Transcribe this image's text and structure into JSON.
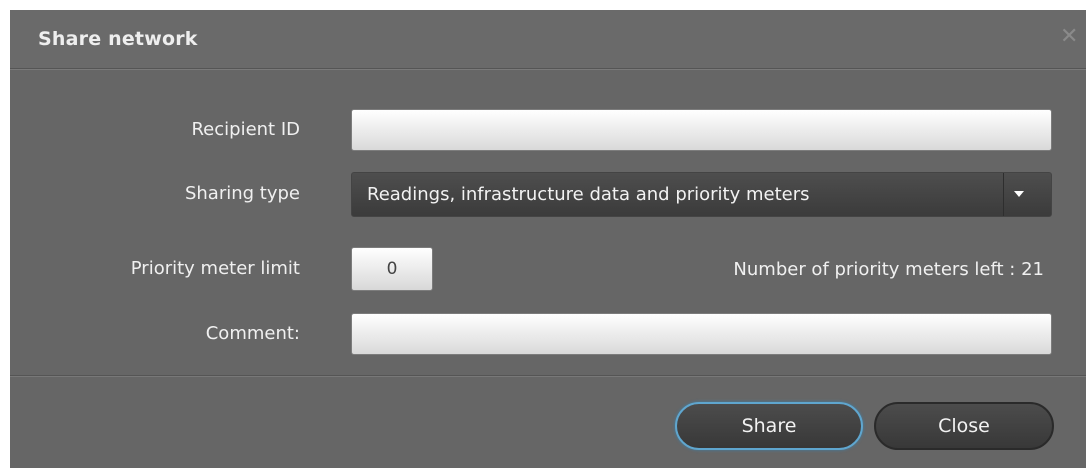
{
  "dialog": {
    "title": "Share network",
    "close_icon": "close-icon",
    "close_glyph": "✕"
  },
  "form": {
    "recipient": {
      "label": "Recipient ID",
      "value": "",
      "placeholder": ""
    },
    "sharing_type": {
      "label": "Sharing type",
      "selected": "Readings, infrastructure data and priority meters",
      "arrow_icon": "chevron-down-icon"
    },
    "priority_limit": {
      "label": "Priority meter limit",
      "value": "0"
    },
    "meters_left": "Number of priority meters left : 21",
    "comment": {
      "label": "Comment:",
      "value": "",
      "placeholder": ""
    }
  },
  "buttons": {
    "share": "Share",
    "close": "Close"
  },
  "colors": {
    "dialog_bg": "#666666",
    "select_bg": "#3f3f3f",
    "focus_ring": "#5fa6cf"
  }
}
